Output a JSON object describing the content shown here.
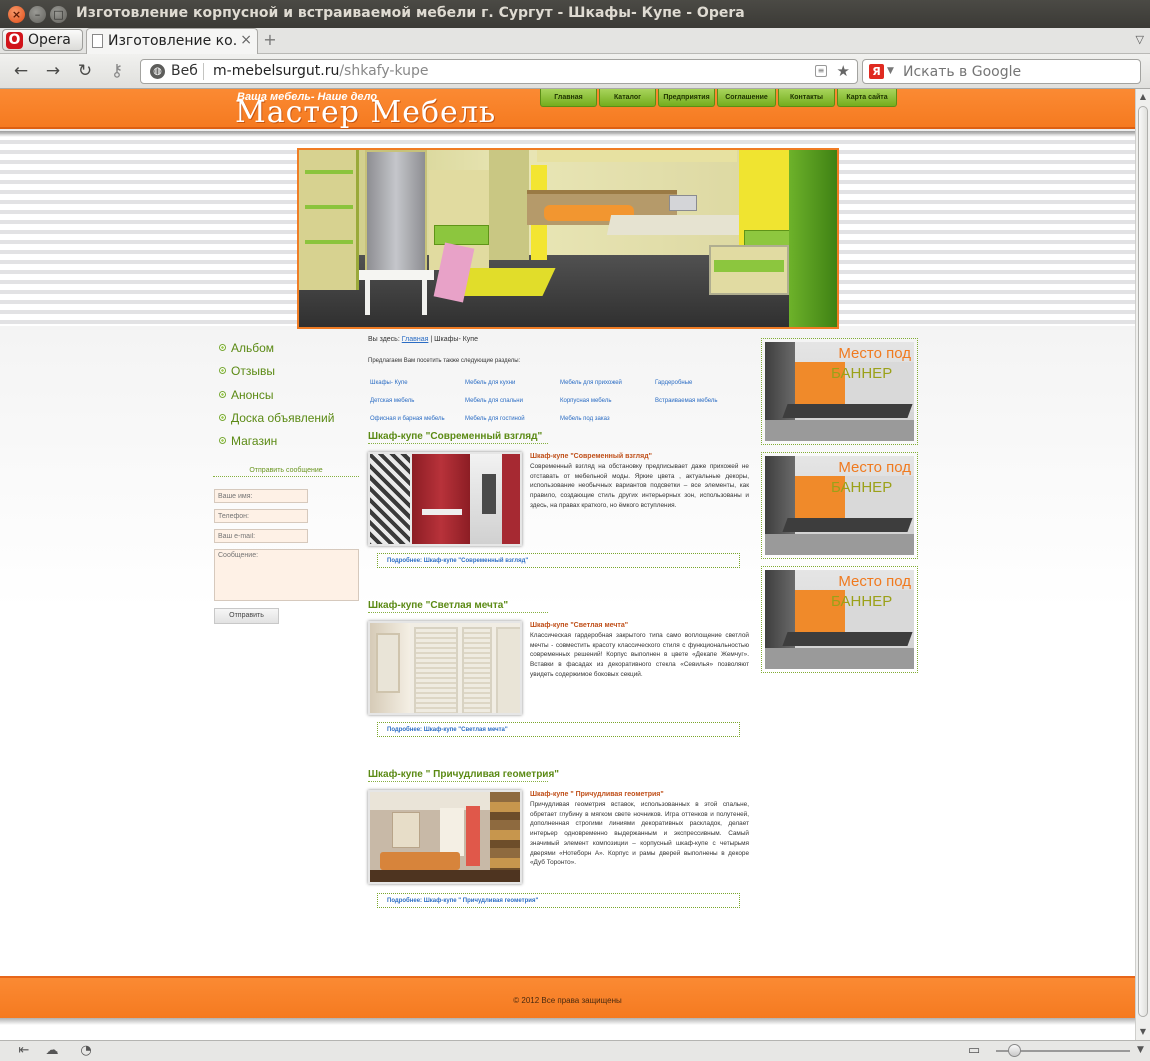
{
  "window": {
    "title": "Изготовление корпусной и встраиваемой мебели г. Сургут - Шкафы- Купе - Opera"
  },
  "browser": {
    "menu_label": "Opera",
    "tab_title": "Изготовление ко...",
    "web_label": "Веб",
    "url_host": "m-mebelsurgut.ru",
    "url_path": "/shkafy-kupe",
    "search_placeholder": "Искать в Google",
    "search_engine_letter": "Я"
  },
  "header": {
    "slogan": "Ваша мебель- Наше дело",
    "logo": "Мастер Мебель",
    "menu": [
      "Главная",
      "Каталог",
      "Предприятия",
      "Соглашение",
      "Контакты",
      "Карта сайта"
    ]
  },
  "sidebar": {
    "items": [
      "Альбом",
      "Отзывы",
      "Анонсы",
      "Доска объявлений",
      "Магазин"
    ],
    "form": {
      "title": "Отправить сообщение",
      "name_placeholder": "Ваше имя:",
      "phone_placeholder": "Телефон:",
      "email_placeholder": "Ваш e-mail:",
      "message_placeholder": "Сообщение:",
      "submit_label": "Отправить"
    }
  },
  "breadcrumb": {
    "prefix": "Вы здесь:",
    "home": "Главная",
    "separator": "|",
    "current": "Шкафы- Купе"
  },
  "suggest": {
    "text": "Предлагаем Вам посетить также следующие разделы:",
    "links": [
      "Шкафы- Купе",
      "Мебель для кухни",
      "Мебель для прихожей",
      "Гардеробные",
      "Детская мебель",
      "Мебель для спальни",
      "Корпусная мебель",
      "Встраиваемая мебель",
      "Офисная и барная мебель",
      "Мебель для гостиной",
      "Мебель под заказ"
    ]
  },
  "products": [
    {
      "title": "Шкаф-купе \"Современный взгляд\"",
      "name": "Шкаф-купе \"Современный взгляд\"",
      "description": "Современный взгляд на обстановку предписывает даже прихожей не отставать от мебельной моды. Яркие цвета , актуальные декоры, использование необычных вариантов подсветки – все элементы, как правило, создающие стиль других интерьерных зон, использованы и здесь, на правах краткого, но ёмкого вступления.",
      "more": "Подробнее: Шкаф-купе \"Современный взгляд\""
    },
    {
      "title": "Шкаф-купе \"Светлая мечта\"",
      "name": "Шкаф-купе \"Светлая мечта\"",
      "description": "Классическая гардеробная закрытого типа само воплощение светлой мечты - совместить красоту классического стиля с функциональностью современных решений! Корпус выполнен в цвете «Декапе Жемчуг». Вставки в фасадах из декоративного стекла «Севилья» позволяют увидеть содержимое боковых секций.",
      "more": "Подробнее: Шкаф-купе \"Светлая мечта\""
    },
    {
      "title": "Шкаф-купе \" Причудливая геометрия\"",
      "name": "Шкаф-купе \" Причудливая геометрия\"",
      "description": "Причудливая геометрия вставок, использованных в этой спальне, обретает глубину в мягком свете ночников. Игра оттенков и полутеней, дополненная строгими линиями декоративных раскладок, делает интерьер одновременно выдержанным и экспрессивным. Самый значимый элемент композиции – корпусный шкаф-купе с четырьмя дверями «Нотеборн А». Корпус и рамы дверей выполнены в декоре «Дуб Торонто».",
      "more": "Подробнее: Шкаф-купе \" Причудливая геометрия\""
    }
  ],
  "ads": [
    {
      "line1": "Место под",
      "line2": "БАННЕР"
    },
    {
      "line1": "Место под",
      "line2": "БАННЕР"
    },
    {
      "line1": "Место под",
      "line2": "БАННЕР"
    }
  ],
  "footer": {
    "copyright": "© 2012 Все права защищены"
  },
  "colors": {
    "brand_orange": "#f57a20",
    "menu_green": "#74ad1d",
    "link_blue": "#2a6cc4",
    "title_green": "#5b8a14"
  }
}
